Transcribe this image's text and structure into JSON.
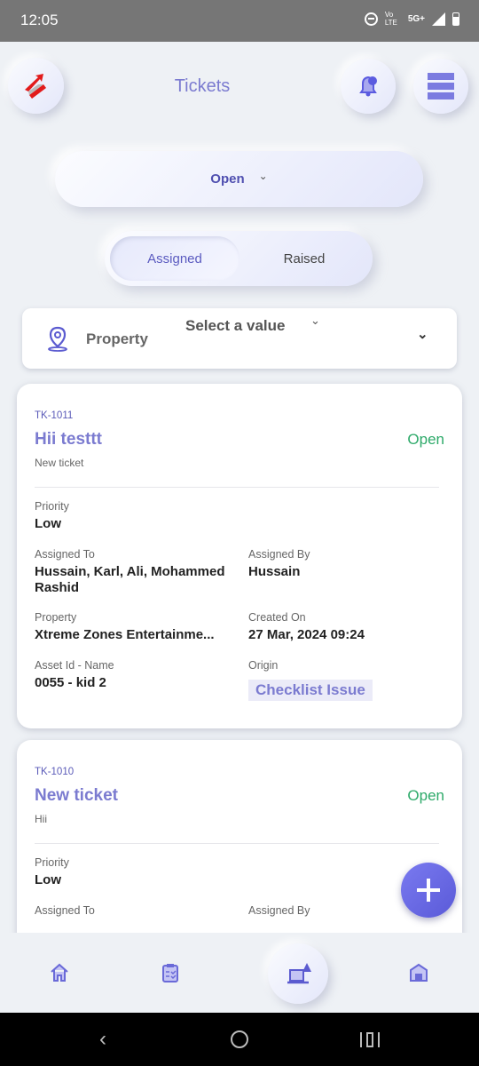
{
  "status_bar": {
    "time": "12:05",
    "network": "5G+",
    "volte": "Vo LTE"
  },
  "header": {
    "title": "Tickets",
    "logo": "app-logo",
    "bell_icon": "bell-icon",
    "menu_icon": "menu-icon"
  },
  "status_filter": {
    "value": "Open"
  },
  "toggle": {
    "options": [
      "Assigned",
      "Raised"
    ],
    "active": "Assigned"
  },
  "property_filter": {
    "label": "Property",
    "placeholder": "Select a value"
  },
  "tickets": [
    {
      "id": "TK-1011",
      "title": "Hii testtt",
      "description": "New ticket",
      "status": "Open",
      "priority_label": "Priority",
      "priority": "Low",
      "assigned_to_label": "Assigned To",
      "assigned_to": "Hussain, Karl, Ali, Mohammed Rashid",
      "assigned_by_label": "Assigned By",
      "assigned_by": "Hussain",
      "property_label": "Property",
      "property": "Xtreme Zones Entertainme...",
      "created_label": "Created On",
      "created": "27 Mar, 2024 09:24",
      "asset_label": "Asset Id - Name",
      "asset": "0055 - kid 2",
      "origin_label": "Origin",
      "origin": "Checklist Issue"
    },
    {
      "id": "TK-1010",
      "title": "New ticket",
      "description": "Hii",
      "status": "Open",
      "priority_label": "Priority",
      "priority": "Low",
      "assigned_to_label": "Assigned To",
      "assigned_by_label": "Assigned By"
    }
  ],
  "colors": {
    "accent": "#7b7bd0",
    "status_open": "#2eaa6a",
    "fab": "#6a6ae6"
  },
  "bottom_nav": [
    "home-icon",
    "checklist-icon",
    "tickets-icon",
    "property-icon"
  ]
}
